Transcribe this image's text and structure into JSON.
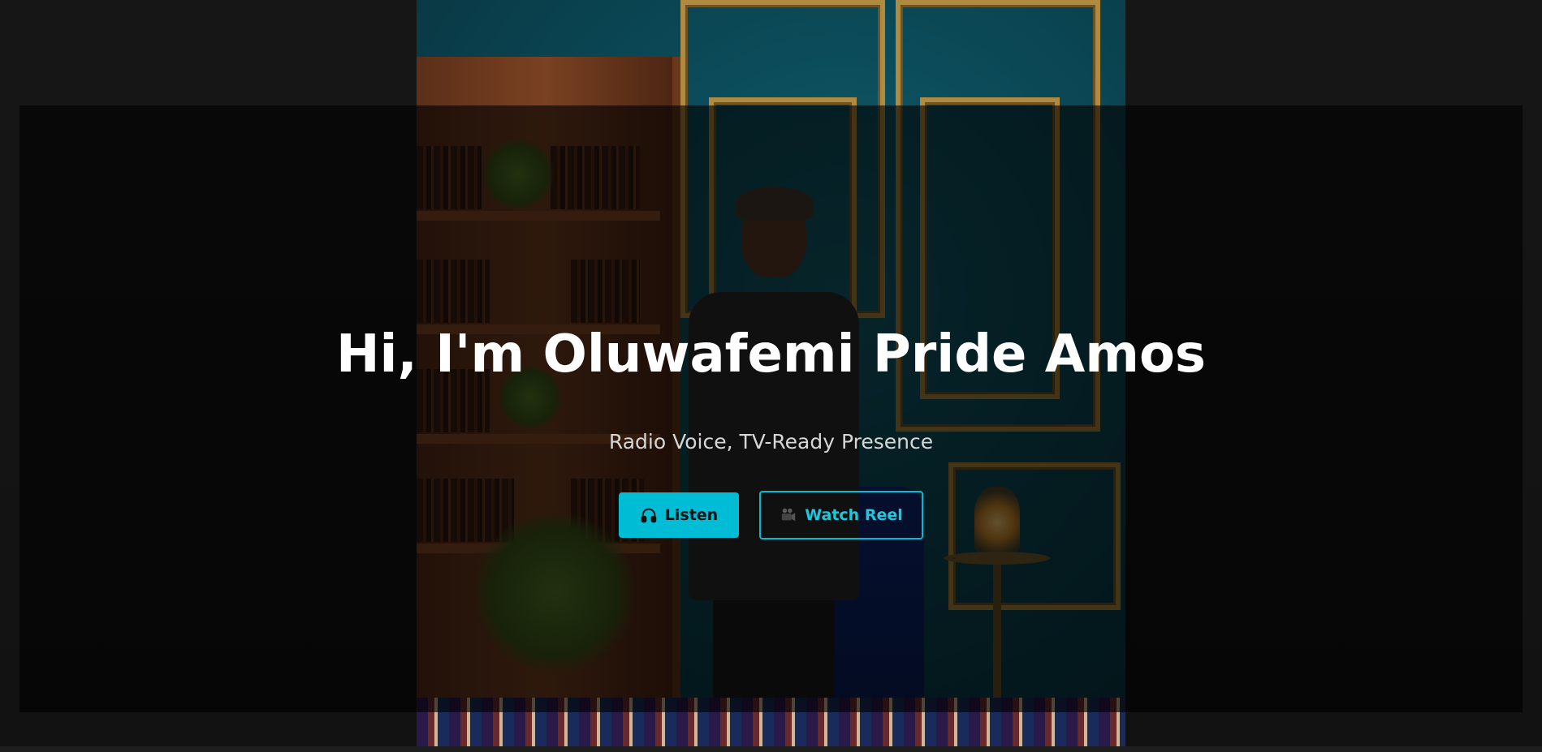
{
  "hero": {
    "title": "Hi, I'm Oluwafemi Pride Amos",
    "subtitle": "Radio Voice, TV-Ready Presence",
    "background_image": "portrait-in-library-room"
  },
  "actions": {
    "listen": {
      "label": "Listen",
      "icon": "headphones-icon"
    },
    "watch_reel": {
      "label": "Watch Reel",
      "icon": "movie-camera-icon"
    }
  },
  "colors": {
    "accent": "#00bcd4",
    "title": "#ffffff",
    "subtitle": "#d6d6d6",
    "page_background": "#141414"
  }
}
